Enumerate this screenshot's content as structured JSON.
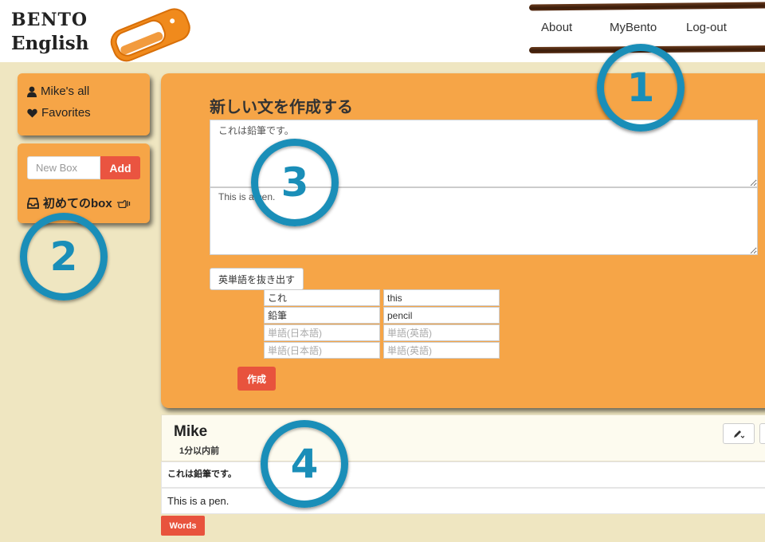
{
  "brand": {
    "line1": "BENTO",
    "line2": "English",
    "accent": "#f6a547",
    "marker_color": "#1a8eb8"
  },
  "nav": {
    "about": "About",
    "mybento": "MyBento",
    "logout": "Log-out"
  },
  "sidebar": {
    "mikes_all": "Mike's all",
    "favorites": "Favorites",
    "new_box_placeholder": "New Box",
    "add_label": "Add",
    "box_name": "初めてのbox",
    "icons": {
      "mikes_all": "user-icon",
      "favorites": "heart-icon",
      "box": "inbox-icon",
      "box_action": "hand-pointer-icon"
    }
  },
  "form": {
    "title": "新しい文を作成する",
    "japanese_text": "これは鉛筆です。",
    "english_text": "This is a pen.",
    "extract_label": "英単語を抜き出す",
    "word_pairs": [
      {
        "ja": "これ",
        "en": "this"
      },
      {
        "ja": "鉛筆",
        "en": "pencil"
      },
      {
        "ja": "",
        "en": ""
      },
      {
        "ja": "",
        "en": ""
      }
    ],
    "ja_placeholder": "単語(日本語)",
    "en_placeholder": "単語(英語)",
    "create_label": "作成"
  },
  "post": {
    "author": "Mike",
    "time": "1分以内前",
    "japanese": "これは鉛筆です。",
    "english": "This is a pen.",
    "words_label": "Words",
    "edit_icon": "pencil-icon"
  },
  "markers": [
    "1",
    "2",
    "3",
    "4"
  ]
}
